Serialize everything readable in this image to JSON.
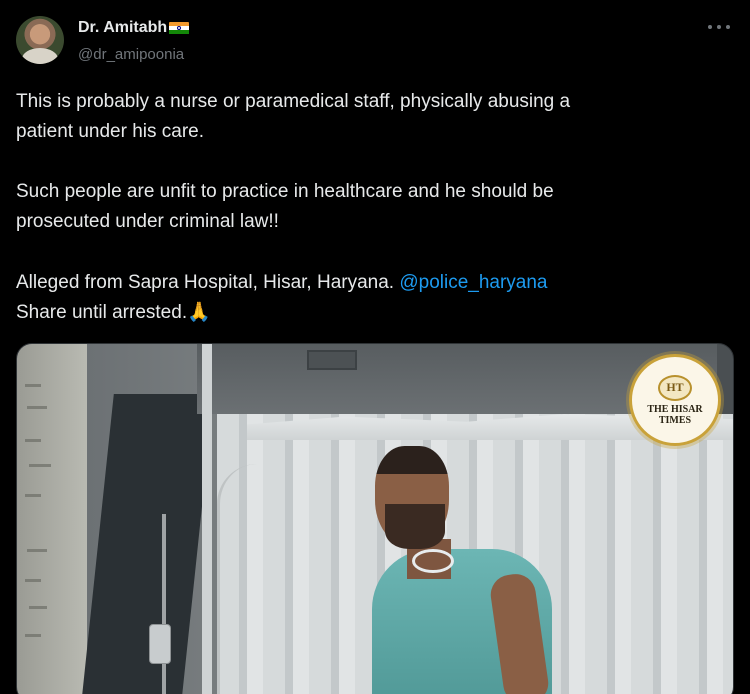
{
  "author": {
    "display_name": "Dr. Amitabh",
    "handle": "@dr_amipoonia",
    "flag_icon": "india-flag-icon"
  },
  "tweet": {
    "line1": "This is probably a nurse or paramedical staff, physically abusing a",
    "line2": "patient under his care.",
    "line3": "Such people are unfit to practice in healthcare and he should be",
    "line4": "prosecuted under criminal law!!",
    "line5": "Alleged from Sapra Hospital, Hisar, Haryana. ",
    "mention": "@police_haryana",
    "line6": "Share until arrested.",
    "emoji": "🙏"
  },
  "media": {
    "watermark_initials": "HT",
    "watermark_text": "THE HISAR TIMES"
  },
  "colors": {
    "background": "#000000",
    "text": "#e7e9ea",
    "secondary": "#71767b",
    "link": "#1d9bf0"
  }
}
